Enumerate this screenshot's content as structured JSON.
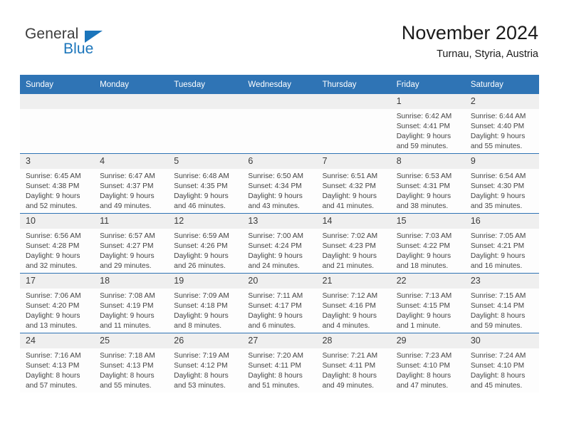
{
  "logo": {
    "word1": "General",
    "word2": "Blue",
    "triangle_color": "#1b75bb",
    "word1_color": "#3c3c3c",
    "word2_color": "#1b75bb"
  },
  "header": {
    "title": "November 2024",
    "subtitle": "Turnau, Styria, Austria"
  },
  "theme": {
    "header_blue": "#2f74b5",
    "daynum_band": "#efefef",
    "cell_bg": "#fdfdfd",
    "text": "#444444"
  },
  "weekday_headers": [
    "Sunday",
    "Monday",
    "Tuesday",
    "Wednesday",
    "Thursday",
    "Friday",
    "Saturday"
  ],
  "weeks": [
    [
      {
        "day": "",
        "empty": true,
        "sunrise": "",
        "sunset": "",
        "daylight_line1": "",
        "daylight_line2": ""
      },
      {
        "day": "",
        "empty": true,
        "sunrise": "",
        "sunset": "",
        "daylight_line1": "",
        "daylight_line2": ""
      },
      {
        "day": "",
        "empty": true,
        "sunrise": "",
        "sunset": "",
        "daylight_line1": "",
        "daylight_line2": ""
      },
      {
        "day": "",
        "empty": true,
        "sunrise": "",
        "sunset": "",
        "daylight_line1": "",
        "daylight_line2": ""
      },
      {
        "day": "",
        "empty": true,
        "sunrise": "",
        "sunset": "",
        "daylight_line1": "",
        "daylight_line2": ""
      },
      {
        "day": "1",
        "empty": false,
        "sunrise": "Sunrise: 6:42 AM",
        "sunset": "Sunset: 4:41 PM",
        "daylight_line1": "Daylight: 9 hours",
        "daylight_line2": "and 59 minutes."
      },
      {
        "day": "2",
        "empty": false,
        "sunrise": "Sunrise: 6:44 AM",
        "sunset": "Sunset: 4:40 PM",
        "daylight_line1": "Daylight: 9 hours",
        "daylight_line2": "and 55 minutes."
      }
    ],
    [
      {
        "day": "3",
        "empty": false,
        "sunrise": "Sunrise: 6:45 AM",
        "sunset": "Sunset: 4:38 PM",
        "daylight_line1": "Daylight: 9 hours",
        "daylight_line2": "and 52 minutes."
      },
      {
        "day": "4",
        "empty": false,
        "sunrise": "Sunrise: 6:47 AM",
        "sunset": "Sunset: 4:37 PM",
        "daylight_line1": "Daylight: 9 hours",
        "daylight_line2": "and 49 minutes."
      },
      {
        "day": "5",
        "empty": false,
        "sunrise": "Sunrise: 6:48 AM",
        "sunset": "Sunset: 4:35 PM",
        "daylight_line1": "Daylight: 9 hours",
        "daylight_line2": "and 46 minutes."
      },
      {
        "day": "6",
        "empty": false,
        "sunrise": "Sunrise: 6:50 AM",
        "sunset": "Sunset: 4:34 PM",
        "daylight_line1": "Daylight: 9 hours",
        "daylight_line2": "and 43 minutes."
      },
      {
        "day": "7",
        "empty": false,
        "sunrise": "Sunrise: 6:51 AM",
        "sunset": "Sunset: 4:32 PM",
        "daylight_line1": "Daylight: 9 hours",
        "daylight_line2": "and 41 minutes."
      },
      {
        "day": "8",
        "empty": false,
        "sunrise": "Sunrise: 6:53 AM",
        "sunset": "Sunset: 4:31 PM",
        "daylight_line1": "Daylight: 9 hours",
        "daylight_line2": "and 38 minutes."
      },
      {
        "day": "9",
        "empty": false,
        "sunrise": "Sunrise: 6:54 AM",
        "sunset": "Sunset: 4:30 PM",
        "daylight_line1": "Daylight: 9 hours",
        "daylight_line2": "and 35 minutes."
      }
    ],
    [
      {
        "day": "10",
        "empty": false,
        "sunrise": "Sunrise: 6:56 AM",
        "sunset": "Sunset: 4:28 PM",
        "daylight_line1": "Daylight: 9 hours",
        "daylight_line2": "and 32 minutes."
      },
      {
        "day": "11",
        "empty": false,
        "sunrise": "Sunrise: 6:57 AM",
        "sunset": "Sunset: 4:27 PM",
        "daylight_line1": "Daylight: 9 hours",
        "daylight_line2": "and 29 minutes."
      },
      {
        "day": "12",
        "empty": false,
        "sunrise": "Sunrise: 6:59 AM",
        "sunset": "Sunset: 4:26 PM",
        "daylight_line1": "Daylight: 9 hours",
        "daylight_line2": "and 26 minutes."
      },
      {
        "day": "13",
        "empty": false,
        "sunrise": "Sunrise: 7:00 AM",
        "sunset": "Sunset: 4:24 PM",
        "daylight_line1": "Daylight: 9 hours",
        "daylight_line2": "and 24 minutes."
      },
      {
        "day": "14",
        "empty": false,
        "sunrise": "Sunrise: 7:02 AM",
        "sunset": "Sunset: 4:23 PM",
        "daylight_line1": "Daylight: 9 hours",
        "daylight_line2": "and 21 minutes."
      },
      {
        "day": "15",
        "empty": false,
        "sunrise": "Sunrise: 7:03 AM",
        "sunset": "Sunset: 4:22 PM",
        "daylight_line1": "Daylight: 9 hours",
        "daylight_line2": "and 18 minutes."
      },
      {
        "day": "16",
        "empty": false,
        "sunrise": "Sunrise: 7:05 AM",
        "sunset": "Sunset: 4:21 PM",
        "daylight_line1": "Daylight: 9 hours",
        "daylight_line2": "and 16 minutes."
      }
    ],
    [
      {
        "day": "17",
        "empty": false,
        "sunrise": "Sunrise: 7:06 AM",
        "sunset": "Sunset: 4:20 PM",
        "daylight_line1": "Daylight: 9 hours",
        "daylight_line2": "and 13 minutes."
      },
      {
        "day": "18",
        "empty": false,
        "sunrise": "Sunrise: 7:08 AM",
        "sunset": "Sunset: 4:19 PM",
        "daylight_line1": "Daylight: 9 hours",
        "daylight_line2": "and 11 minutes."
      },
      {
        "day": "19",
        "empty": false,
        "sunrise": "Sunrise: 7:09 AM",
        "sunset": "Sunset: 4:18 PM",
        "daylight_line1": "Daylight: 9 hours",
        "daylight_line2": "and 8 minutes."
      },
      {
        "day": "20",
        "empty": false,
        "sunrise": "Sunrise: 7:11 AM",
        "sunset": "Sunset: 4:17 PM",
        "daylight_line1": "Daylight: 9 hours",
        "daylight_line2": "and 6 minutes."
      },
      {
        "day": "21",
        "empty": false,
        "sunrise": "Sunrise: 7:12 AM",
        "sunset": "Sunset: 4:16 PM",
        "daylight_line1": "Daylight: 9 hours",
        "daylight_line2": "and 4 minutes."
      },
      {
        "day": "22",
        "empty": false,
        "sunrise": "Sunrise: 7:13 AM",
        "sunset": "Sunset: 4:15 PM",
        "daylight_line1": "Daylight: 9 hours",
        "daylight_line2": "and 1 minute."
      },
      {
        "day": "23",
        "empty": false,
        "sunrise": "Sunrise: 7:15 AM",
        "sunset": "Sunset: 4:14 PM",
        "daylight_line1": "Daylight: 8 hours",
        "daylight_line2": "and 59 minutes."
      }
    ],
    [
      {
        "day": "24",
        "empty": false,
        "sunrise": "Sunrise: 7:16 AM",
        "sunset": "Sunset: 4:13 PM",
        "daylight_line1": "Daylight: 8 hours",
        "daylight_line2": "and 57 minutes."
      },
      {
        "day": "25",
        "empty": false,
        "sunrise": "Sunrise: 7:18 AM",
        "sunset": "Sunset: 4:13 PM",
        "daylight_line1": "Daylight: 8 hours",
        "daylight_line2": "and 55 minutes."
      },
      {
        "day": "26",
        "empty": false,
        "sunrise": "Sunrise: 7:19 AM",
        "sunset": "Sunset: 4:12 PM",
        "daylight_line1": "Daylight: 8 hours",
        "daylight_line2": "and 53 minutes."
      },
      {
        "day": "27",
        "empty": false,
        "sunrise": "Sunrise: 7:20 AM",
        "sunset": "Sunset: 4:11 PM",
        "daylight_line1": "Daylight: 8 hours",
        "daylight_line2": "and 51 minutes."
      },
      {
        "day": "28",
        "empty": false,
        "sunrise": "Sunrise: 7:21 AM",
        "sunset": "Sunset: 4:11 PM",
        "daylight_line1": "Daylight: 8 hours",
        "daylight_line2": "and 49 minutes."
      },
      {
        "day": "29",
        "empty": false,
        "sunrise": "Sunrise: 7:23 AM",
        "sunset": "Sunset: 4:10 PM",
        "daylight_line1": "Daylight: 8 hours",
        "daylight_line2": "and 47 minutes."
      },
      {
        "day": "30",
        "empty": false,
        "sunrise": "Sunrise: 7:24 AM",
        "sunset": "Sunset: 4:10 PM",
        "daylight_line1": "Daylight: 8 hours",
        "daylight_line2": "and 45 minutes."
      }
    ]
  ]
}
